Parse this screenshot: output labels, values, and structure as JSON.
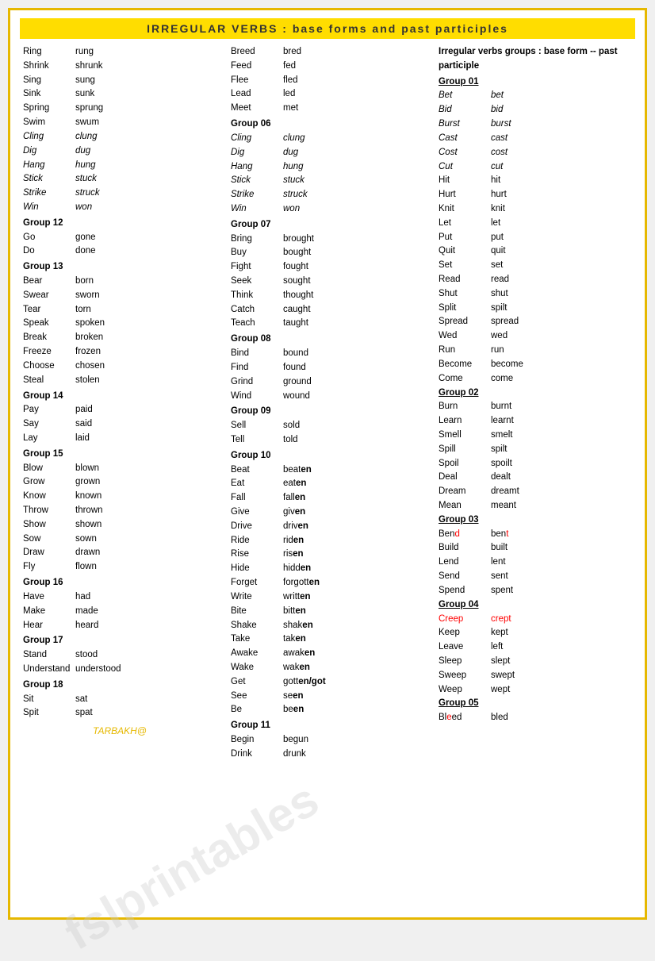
{
  "header": {
    "title": "IRREGULAR   VERBS   :   base forms  and past participles"
  },
  "col1": {
    "rows": [
      {
        "base": "Ring",
        "past": "rung",
        "style": "normal"
      },
      {
        "base": "Shrink",
        "past": "shrunk",
        "style": "normal"
      },
      {
        "base": "Sing",
        "past": "sung",
        "style": "normal"
      },
      {
        "base": "Sink",
        "past": "sunk",
        "style": "normal"
      },
      {
        "base": "Spring",
        "past": "sprung",
        "style": "normal"
      },
      {
        "base": "Swim",
        "past": "swum",
        "style": "normal"
      },
      {
        "base": "Cling",
        "past": "clung",
        "style": "italic"
      },
      {
        "base": "Dig",
        "past": "dug",
        "style": "italic"
      },
      {
        "base": "Hang",
        "past": "hung",
        "style": "italic"
      },
      {
        "base": "Stick",
        "past": "stuck",
        "style": "italic"
      },
      {
        "base": "Strike",
        "past": "struck",
        "style": "italic"
      },
      {
        "base": "Win",
        "past": "won",
        "style": "italic"
      },
      {
        "group": "Group 12"
      },
      {
        "base": "Go",
        "past": "gone",
        "style": "normal"
      },
      {
        "base": "Do",
        "past": "done",
        "style": "normal"
      },
      {
        "group": "Group 13"
      },
      {
        "base": "Bear",
        "past": "born",
        "style": "normal"
      },
      {
        "base": "Swear",
        "past": "sworn",
        "style": "normal"
      },
      {
        "base": "Tear",
        "past": "torn",
        "style": "normal"
      },
      {
        "base": "Speak",
        "past": "spoken",
        "style": "normal"
      },
      {
        "base": "Break",
        "past": "broken",
        "style": "normal"
      },
      {
        "base": "Freeze",
        "past": "frozen",
        "style": "normal"
      },
      {
        "base": "Choose",
        "past": "chosen",
        "style": "normal"
      },
      {
        "base": "Steal",
        "past": "stolen",
        "style": "normal"
      },
      {
        "group": "Group 14"
      },
      {
        "base": "Pay",
        "past": "paid",
        "style": "normal"
      },
      {
        "base": "Say",
        "past": "said",
        "style": "normal"
      },
      {
        "base": "Lay",
        "past": "laid",
        "style": "normal"
      },
      {
        "group": "Group 15"
      },
      {
        "base": "Blow",
        "past": "blown",
        "style": "normal"
      },
      {
        "base": "Grow",
        "past": "grown",
        "style": "normal"
      },
      {
        "base": "Know",
        "past": "known",
        "style": "normal"
      },
      {
        "base": "Throw",
        "past": "thrown",
        "style": "normal"
      },
      {
        "base": "Show",
        "past": "shown",
        "style": "normal"
      },
      {
        "base": "Sow",
        "past": "sown",
        "style": "normal"
      },
      {
        "base": "Draw",
        "past": "drawn",
        "style": "normal"
      },
      {
        "base": "Fly",
        "past": "flown",
        "style": "normal"
      },
      {
        "group": "Group 16"
      },
      {
        "base": "Have",
        "past": "had",
        "style": "normal"
      },
      {
        "base": "Make",
        "past": "made",
        "style": "normal"
      },
      {
        "base": "Hear",
        "past": "heard",
        "style": "normal"
      },
      {
        "group": "Group 17"
      },
      {
        "base": "Stand",
        "past": "stood",
        "style": "normal"
      },
      {
        "base": "Understand",
        "past": "understood",
        "style": "normal"
      },
      {
        "group": "Group 18"
      },
      {
        "base": "Sit",
        "past": "sat",
        "style": "normal"
      },
      {
        "base": "Spit",
        "past": "spat",
        "style": "normal"
      }
    ],
    "attribution": "TARBAKH@"
  },
  "col2": {
    "rows": [
      {
        "base": "Breed",
        "past": "bred",
        "style": "normal"
      },
      {
        "base": "Feed",
        "past": "fed",
        "style": "normal"
      },
      {
        "base": "Flee",
        "past": "fled",
        "style": "normal"
      },
      {
        "base": "Lead",
        "past": "led",
        "style": "normal"
      },
      {
        "base": "Meet",
        "past": "met",
        "style": "normal"
      },
      {
        "group": "Group 06"
      },
      {
        "base": "Cling",
        "past": "clung",
        "style": "italic"
      },
      {
        "base": "Dig",
        "past": "dug",
        "style": "italic"
      },
      {
        "base": "Hang",
        "past": "hung",
        "style": "italic"
      },
      {
        "base": "Stick",
        "past": "stuck",
        "style": "italic"
      },
      {
        "base": "Strike",
        "past": "struck",
        "style": "italic"
      },
      {
        "base": "Win",
        "past": "won",
        "style": "italic"
      },
      {
        "group": "Group 07"
      },
      {
        "base": "Bring",
        "past": "brought",
        "style": "normal"
      },
      {
        "base": "Buy",
        "past": "bought",
        "style": "normal"
      },
      {
        "base": "Fight",
        "past": "fought",
        "style": "normal"
      },
      {
        "base": "Seek",
        "past": "sought",
        "style": "normal"
      },
      {
        "base": "Think",
        "past": "thought",
        "style": "normal"
      },
      {
        "base": "Catch",
        "past": "caught",
        "style": "normal"
      },
      {
        "base": "Teach",
        "past": "taught",
        "style": "normal"
      },
      {
        "group": "Group 08"
      },
      {
        "base": "Bind",
        "past": "bound",
        "style": "normal"
      },
      {
        "base": "Find",
        "past": "found",
        "style": "normal"
      },
      {
        "base": "Grind",
        "past": "ground",
        "style": "normal"
      },
      {
        "base": "Wind",
        "past": "wound",
        "style": "normal"
      },
      {
        "group": "Group 09"
      },
      {
        "base": "Sell",
        "past": "sold",
        "style": "normal"
      },
      {
        "base": "Tell",
        "past": "told",
        "style": "normal"
      },
      {
        "group": "Group 10"
      },
      {
        "base": "Beat",
        "past": "beaten",
        "style": "normal",
        "en": true
      },
      {
        "base": "Eat",
        "past": "eaten",
        "style": "normal",
        "en": true
      },
      {
        "base": "Fall",
        "past": "fallen",
        "style": "normal",
        "en": true
      },
      {
        "base": "Give",
        "past": "given",
        "style": "normal",
        "en": true
      },
      {
        "base": "Drive",
        "past": "driven",
        "style": "normal",
        "en": true
      },
      {
        "base": "Ride",
        "past": "riden",
        "style": "normal",
        "en": true
      },
      {
        "base": "Rise",
        "past": "risen",
        "style": "normal",
        "en": true
      },
      {
        "base": "Hide",
        "past": "hidden",
        "style": "normal",
        "en": true
      },
      {
        "base": "Forget",
        "past": "forgotten",
        "style": "normal",
        "en": true
      },
      {
        "base": "Write",
        "past": "written",
        "style": "normal",
        "en": true
      },
      {
        "base": "Bite",
        "past": "bitten",
        "style": "normal",
        "en": true
      },
      {
        "base": "Shake",
        "past": "shaken",
        "style": "normal",
        "en": true
      },
      {
        "base": "Take",
        "past": "taken",
        "style": "normal",
        "en": true
      },
      {
        "base": "Awake",
        "past": "awaken",
        "style": "normal",
        "en": true
      },
      {
        "base": "Wake",
        "past": "waken",
        "style": "normal",
        "en": true
      },
      {
        "base": "Get",
        "past": "gotten/got",
        "style": "normal",
        "en": true
      },
      {
        "base": "See",
        "past": "seen",
        "style": "normal",
        "en": true
      },
      {
        "base": "Be",
        "past": "been",
        "style": "normal",
        "en": true
      },
      {
        "group": "Group 11"
      },
      {
        "base": "Begin",
        "past": "begun",
        "style": "normal"
      },
      {
        "base": "Drink",
        "past": "drunk",
        "style": "normal"
      }
    ]
  },
  "col3": {
    "header": "Irregular verbs groups : base form --  past participle",
    "groups": [
      {
        "label": "Group 01",
        "rows": [
          {
            "base": "Bet",
            "past": "bet",
            "style": "italic"
          },
          {
            "base": "Bid",
            "past": "bid",
            "style": "italic"
          },
          {
            "base": "Burst",
            "past": "burst",
            "style": "italic"
          },
          {
            "base": "Cast",
            "past": "cast",
            "style": "italic"
          },
          {
            "base": "Cost",
            "past": "cost",
            "style": "italic"
          },
          {
            "base": "Cut",
            "past": "cut",
            "style": "italic"
          },
          {
            "base": "Hit",
            "past": "hit",
            "style": "normal"
          },
          {
            "base": "Hurt",
            "past": "hurt",
            "style": "normal"
          },
          {
            "base": "Knit",
            "past": "knit",
            "style": "normal"
          },
          {
            "base": "Let",
            "past": "let",
            "style": "normal"
          },
          {
            "base": "Put",
            "past": "put",
            "style": "normal"
          },
          {
            "base": "Quit",
            "past": "quit",
            "style": "normal"
          },
          {
            "base": "Set",
            "past": "set",
            "style": "normal"
          },
          {
            "base": "Read",
            "past": "read",
            "style": "normal"
          },
          {
            "base": "Shut",
            "past": "shut",
            "style": "normal"
          },
          {
            "base": "Split",
            "past": "spilt",
            "style": "normal"
          },
          {
            "base": "Spread",
            "past": "spread",
            "style": "normal"
          },
          {
            "base": "Wed",
            "past": "wed",
            "style": "normal"
          },
          {
            "base": "Run",
            "past": "run",
            "style": "normal"
          },
          {
            "base": "Become",
            "past": "become",
            "style": "normal"
          },
          {
            "base": "Come",
            "past": "come",
            "style": "normal"
          }
        ]
      },
      {
        "label": "Group 02",
        "rows": [
          {
            "base": "Burn",
            "past": "burnt",
            "style": "normal"
          },
          {
            "base": "Learn",
            "past": "learnt",
            "style": "normal"
          },
          {
            "base": "Smell",
            "past": "smelt",
            "style": "normal"
          },
          {
            "base": "Spill",
            "past": "spilt",
            "style": "normal"
          },
          {
            "base": "Spoil",
            "past": "spoilt",
            "style": "normal"
          },
          {
            "base": "Deal",
            "past": "dealt",
            "style": "normal"
          },
          {
            "base": "Dream",
            "past": "dreamt",
            "style": "normal"
          },
          {
            "base": "Mean",
            "past": "meant",
            "style": "normal"
          }
        ]
      },
      {
        "label": "Group 03",
        "rows": [
          {
            "base": "Bend",
            "past": "bent",
            "style": "normal",
            "red_base": true
          },
          {
            "base": "Build",
            "past": "built",
            "style": "normal"
          },
          {
            "base": "Lend",
            "past": "lent",
            "style": "normal"
          },
          {
            "base": "Send",
            "past": "sent",
            "style": "normal"
          },
          {
            "base": "Spend",
            "past": "spent",
            "style": "normal"
          }
        ]
      },
      {
        "label": "Group 04",
        "rows": [
          {
            "base": "Creep",
            "past": "crept",
            "style": "normal",
            "red_row": true
          },
          {
            "base": "Keep",
            "past": "kept",
            "style": "normal"
          },
          {
            "base": "Leave",
            "past": "left",
            "style": "normal"
          },
          {
            "base": "Sleep",
            "past": "slept",
            "style": "normal"
          },
          {
            "base": "Sweep",
            "past": "swept",
            "style": "normal"
          },
          {
            "base": "Weep",
            "past": "wept",
            "style": "normal"
          }
        ]
      },
      {
        "label": "Group 05",
        "rows": [
          {
            "base": "Bleed",
            "past": "bled",
            "style": "normal",
            "red_base": true
          }
        ]
      }
    ]
  }
}
